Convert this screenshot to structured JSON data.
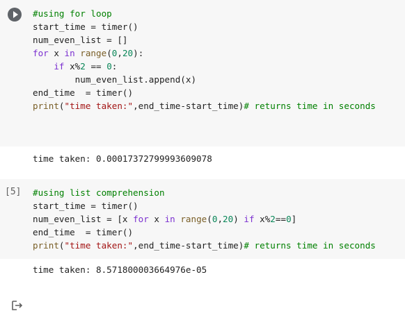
{
  "cell1": {
    "lines": [
      [
        {
          "t": "#using for loop",
          "c": "cm"
        }
      ],
      [
        {
          "t": "start_time = timer()",
          "c": ""
        }
      ],
      [
        {
          "t": "num_even_list = []",
          "c": ""
        }
      ],
      [
        {
          "t": "for",
          "c": "kw"
        },
        {
          "t": " x ",
          "c": ""
        },
        {
          "t": "in",
          "c": "kw"
        },
        {
          "t": " ",
          "c": ""
        },
        {
          "t": "range",
          "c": "bi"
        },
        {
          "t": "(",
          "c": ""
        },
        {
          "t": "0",
          "c": "num"
        },
        {
          "t": ",",
          "c": ""
        },
        {
          "t": "20",
          "c": "num"
        },
        {
          "t": "):",
          "c": ""
        }
      ],
      [
        {
          "t": "    ",
          "c": ""
        },
        {
          "t": "if",
          "c": "kw"
        },
        {
          "t": " x%",
          "c": ""
        },
        {
          "t": "2",
          "c": "num"
        },
        {
          "t": " == ",
          "c": ""
        },
        {
          "t": "0",
          "c": "num"
        },
        {
          "t": ":",
          "c": ""
        }
      ],
      [
        {
          "t": "        num_even_list.append(x)",
          "c": ""
        }
      ],
      [
        {
          "t": "end_time  = timer()",
          "c": ""
        }
      ],
      [
        {
          "t": "print",
          "c": "bi"
        },
        {
          "t": "(",
          "c": ""
        },
        {
          "t": "\"time taken:\"",
          "c": "st"
        },
        {
          "t": ",end_time-start_time)",
          "c": ""
        },
        {
          "t": "# returns time in seconds",
          "c": "cm"
        }
      ]
    ]
  },
  "output1": {
    "text": "time taken: 0.00017372799993609078"
  },
  "cell2": {
    "exec_count": "[5]",
    "lines": [
      [
        {
          "t": "#using list comprehension",
          "c": "cm"
        }
      ],
      [
        {
          "t": "start_time = timer()",
          "c": ""
        }
      ],
      [
        {
          "t": "num_even_list = [x ",
          "c": ""
        },
        {
          "t": "for",
          "c": "kw"
        },
        {
          "t": " x ",
          "c": ""
        },
        {
          "t": "in",
          "c": "kw"
        },
        {
          "t": " ",
          "c": ""
        },
        {
          "t": "range",
          "c": "bi"
        },
        {
          "t": "(",
          "c": ""
        },
        {
          "t": "0",
          "c": "num"
        },
        {
          "t": ",",
          "c": ""
        },
        {
          "t": "20",
          "c": "num"
        },
        {
          "t": ") ",
          "c": ""
        },
        {
          "t": "if",
          "c": "kw"
        },
        {
          "t": " x%",
          "c": ""
        },
        {
          "t": "2",
          "c": "num"
        },
        {
          "t": "==",
          "c": ""
        },
        {
          "t": "0",
          "c": "num"
        },
        {
          "t": "]",
          "c": ""
        }
      ],
      [
        {
          "t": "end_time  = timer()",
          "c": ""
        }
      ],
      [
        {
          "t": "print",
          "c": "bi"
        },
        {
          "t": "(",
          "c": ""
        },
        {
          "t": "\"time taken:\"",
          "c": "st"
        },
        {
          "t": ",end_time-start_time)",
          "c": ""
        },
        {
          "t": "# returns time in seconds",
          "c": "cm"
        }
      ]
    ]
  },
  "output2": {
    "text": "time taken: 8.571800003664976e-05"
  },
  "icons": {
    "run": "play-icon",
    "output": "output-arrow-icon"
  },
  "colors": {
    "cell_bg": "#f7f7f7",
    "comment": "#008000",
    "keyword": "#7b30d0",
    "number": "#098658",
    "string": "#a31515",
    "builtin": "#795e26"
  }
}
